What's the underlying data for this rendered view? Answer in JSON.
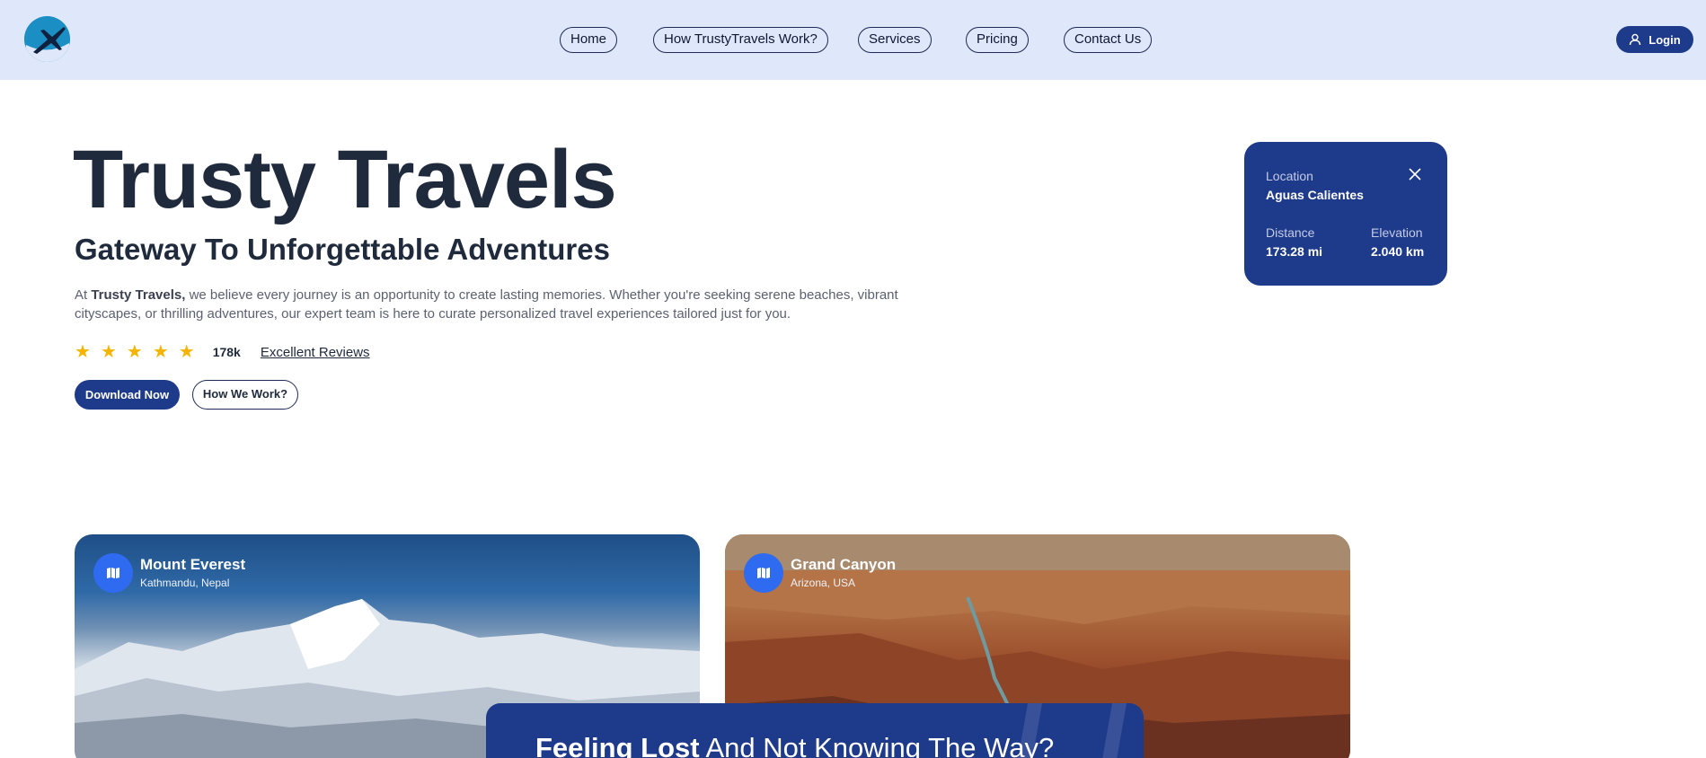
{
  "brand": {
    "logo_icon": "plane-globe-logo-icon"
  },
  "nav": {
    "items": [
      {
        "label": "Home"
      },
      {
        "label": "How TrustyTravels Work?"
      },
      {
        "label": "Services"
      },
      {
        "label": "Pricing"
      },
      {
        "label": "Contact Us"
      }
    ],
    "login_label": "Login",
    "login_icon": "user-icon"
  },
  "hero": {
    "title": "Trusty Travels",
    "subtitle": "Gateway To Unforgettable Adventures",
    "desc_prefix": "At ",
    "desc_brand": "Trusty Travels,",
    "desc_body": " we believe every journey is an opportunity to create lasting memories. Whether you're seeking serene beaches, vibrant cityscapes, or thrilling adventures, our expert team is here to curate personalized travel experiences tailored just for you.",
    "rating_stars": 5,
    "review_count": "178k",
    "reviews_link": "Excellent Reviews",
    "primary_button": "Download Now",
    "secondary_button": "How We Work?"
  },
  "location_card": {
    "location_label": "Location",
    "location_value": "Aguas Calientes",
    "distance_label": "Distance",
    "distance_value": "173.28 mi",
    "elevation_label": "Elevation",
    "elevation_value": "2.040 km",
    "close_icon": "close-icon"
  },
  "destinations": [
    {
      "name": "Mount Everest",
      "location": "Kathmandu, Nepal",
      "icon": "map-icon"
    },
    {
      "name": "Grand Canyon",
      "location": "Arizona, USA",
      "icon": "map-icon"
    }
  ],
  "banner": {
    "bold_text": "Feeling Lost",
    "rest_text": " And Not Knowing The Way?"
  },
  "colors": {
    "header_bg": "#dfe7fb",
    "primary": "#1e3a8a",
    "star": "#f5b400",
    "map_icon_bg": "#2f6bf0"
  }
}
